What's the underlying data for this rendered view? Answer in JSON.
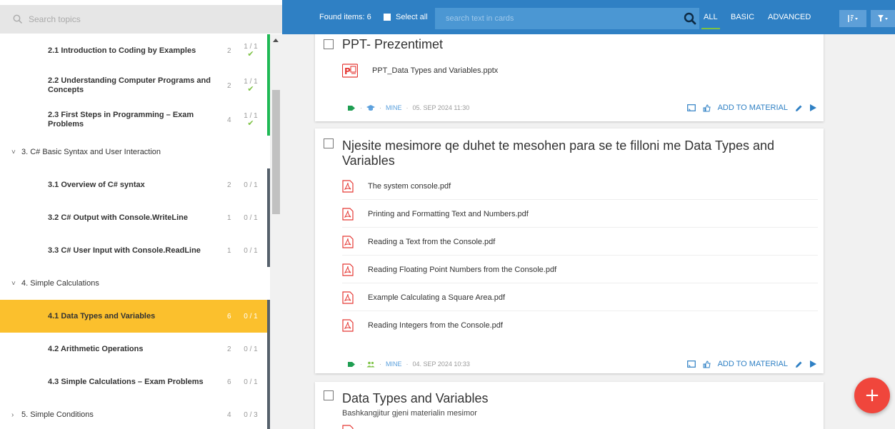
{
  "sidebar": {
    "search_placeholder": "Search topics",
    "items": [
      {
        "kind": "lesson",
        "title": "2.1 Introduction to Coding by Examples",
        "count": "2",
        "progress": "1 / 1",
        "done": true
      },
      {
        "kind": "lesson",
        "title": "2.2 Understanding Computer Programs and Concepts",
        "count": "2",
        "progress": "1 / 1",
        "done": true
      },
      {
        "kind": "lesson",
        "title": "2.3 First Steps in Programming – Exam Problems",
        "count": "4",
        "progress": "1 / 1",
        "done": true
      },
      {
        "kind": "group",
        "title": "3. C# Basic Syntax and User Interaction",
        "chevron": "˅"
      },
      {
        "kind": "lesson",
        "title": "3.1 Overview of C# syntax",
        "count": "2",
        "progress": "0 / 1"
      },
      {
        "kind": "lesson",
        "title": "3.2 C# Output with Console.WriteLine",
        "count": "1",
        "progress": "0 / 1"
      },
      {
        "kind": "lesson",
        "title": "3.3 C# User Input with Console.ReadLine",
        "count": "1",
        "progress": "0 / 1"
      },
      {
        "kind": "group",
        "title": "4. Simple Calculations",
        "chevron": "˅"
      },
      {
        "kind": "lesson",
        "title": "4.1 Data Types and Variables",
        "count": "6",
        "progress": "0 / 1",
        "active": true
      },
      {
        "kind": "lesson",
        "title": "4.2 Arithmetic Operations",
        "count": "2",
        "progress": "0 / 1"
      },
      {
        "kind": "lesson",
        "title": "4.3 Simple Calculations – Exam Problems",
        "count": "6",
        "progress": "0 / 1"
      },
      {
        "kind": "group",
        "title": "5. Simple Conditions",
        "chevron": "›",
        "count": "4",
        "progress": "0 / 3"
      }
    ]
  },
  "toolbar": {
    "found": "Found items: 6",
    "select_all": "Select all",
    "search_placeholder": "search text in cards",
    "filters": [
      "ALL",
      "BASIC",
      "ADVANCED"
    ],
    "sort_icon": "sort-icon",
    "filter_icon": "filter-icon"
  },
  "cards": [
    {
      "title": "PPT- Prezentimet",
      "files": [
        {
          "name": "PPT_Data Types and Variables.pptx",
          "icon": "powerpoint-icon"
        }
      ],
      "meta": {
        "owner": "MINE",
        "date": "05. SEP 2024 11:30",
        "audience_icon": "graduation-cap-icon"
      },
      "action": "ADD TO MATERIAL"
    },
    {
      "title": "Njesite mesimore qe duhet te mesohen para se te filloni me Data Types and Variables",
      "files": [
        {
          "name": "The system console.pdf",
          "icon": "pdf-icon"
        },
        {
          "name": "Printing and Formatting Text and Numbers.pdf",
          "icon": "pdf-icon"
        },
        {
          "name": "Reading a Text from the Console.pdf",
          "icon": "pdf-icon"
        },
        {
          "name": "Reading Floating Point Numbers from the Console.pdf",
          "icon": "pdf-icon"
        },
        {
          "name": "Example Calculating a Square Area.pdf",
          "icon": "pdf-icon"
        },
        {
          "name": "Reading Integers from the Console.pdf",
          "icon": "pdf-icon"
        }
      ],
      "meta": {
        "owner": "MINE",
        "date": "04. SEP 2024 10:33",
        "audience_icon": "group-icon"
      },
      "action": "ADD TO MATERIAL"
    },
    {
      "title": "Data Types and Variables",
      "subtitle": "Bashkangjitur gjeni materialin mesimor"
    }
  ],
  "fab": "+",
  "colors": {
    "topbar": "#2f80c4",
    "active": "#fbc02d",
    "done": "#1fb955",
    "fab": "#f0463c"
  }
}
